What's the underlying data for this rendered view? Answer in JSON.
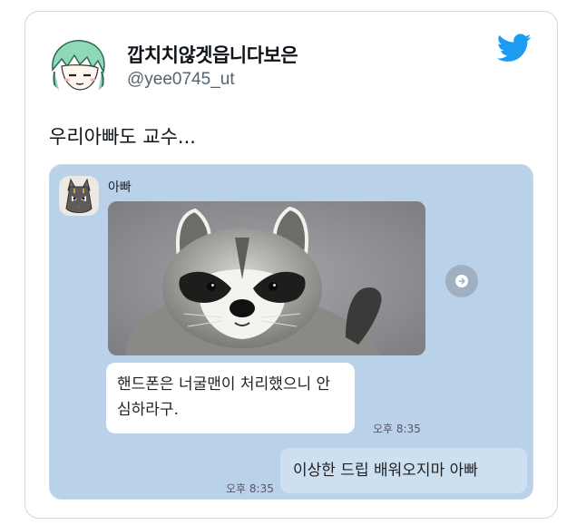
{
  "tweet": {
    "display_name": "깝치치않겟읍니다보은",
    "handle": "@yee0745_ut",
    "text": "우리아빠도 교수...",
    "logo_icon": "twitter-bird-icon",
    "accent_color": "#1d9bf0"
  },
  "chat": {
    "sender_name": "아빠",
    "photo_icon": "raccoon-photo",
    "incoming_message": "핸드폰은 너굴맨이 처리했으니 안심하라구.",
    "incoming_time": "오후 8:35",
    "outgoing_message": "이상한 드립 배워오지마 아빠",
    "outgoing_time": "오후 8:35",
    "background_color": "#b9d2ea"
  }
}
